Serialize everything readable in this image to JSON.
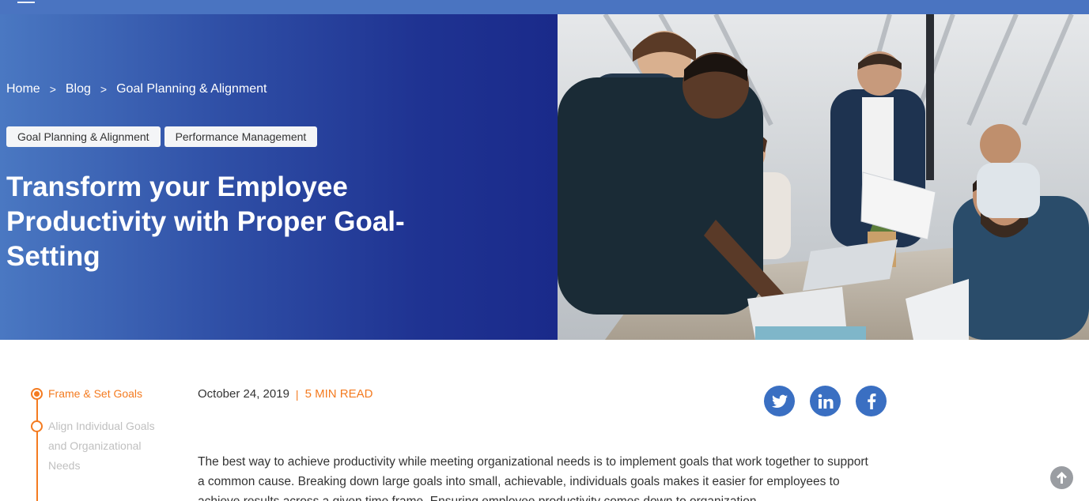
{
  "breadcrumb": {
    "home": "Home",
    "blog": "Blog",
    "current": "Goal Planning & Alignment",
    "separator": ">"
  },
  "tags": [
    "Goal Planning & Alignment",
    "Performance Management"
  ],
  "article": {
    "title": "Transform your Employee Productivity with Proper Goal-Setting",
    "date": "October 24, 2019",
    "divider": "|",
    "read_time": "5 MIN READ",
    "body": "The best way to achieve productivity while meeting organizational needs is to implement goals that work together to support a common cause. Breaking down large goals into small, achievable, individuals goals makes it easier for employees to achieve results across a given time frame. Ensuring employee productivity comes down to organization"
  },
  "toc": {
    "items": [
      {
        "label": "Frame & Set Goals",
        "active": true
      },
      {
        "label": "Align Individual Goals and Organizational Needs",
        "active": false
      }
    ]
  },
  "social": {
    "icons": [
      "twitter-icon",
      "linkedin-icon",
      "facebook-icon"
    ]
  },
  "colors": {
    "accent": "#f47b20",
    "hero_blue_dark": "#1a2a8a",
    "hero_blue_light": "#4a78c2",
    "social_blue": "#3a6fc2",
    "topbar": "#4a74c1"
  }
}
